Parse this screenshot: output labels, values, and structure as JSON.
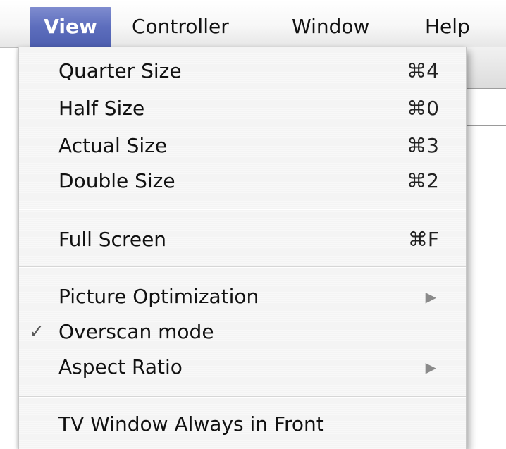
{
  "menubar": {
    "items": [
      {
        "label": "View"
      },
      {
        "label": "Controller"
      },
      {
        "label": "Window"
      },
      {
        "label": "Help"
      }
    ]
  },
  "view_menu": {
    "items": [
      {
        "label": "Quarter Size",
        "shortcut": "⌘4"
      },
      {
        "label": "Half Size",
        "shortcut": "⌘0"
      },
      {
        "label": "Actual Size",
        "shortcut": "⌘3"
      },
      {
        "label": "Double Size",
        "shortcut": "⌘2"
      },
      {
        "label": "Full Screen",
        "shortcut": "⌘F"
      },
      {
        "label": "Picture Optimization",
        "submenu_icon": "submenu-arrow-icon"
      },
      {
        "label": "Overscan mode",
        "checked": true,
        "check_mark": "✓"
      },
      {
        "label": "Aspect Ratio",
        "submenu_icon": "submenu-arrow-icon"
      },
      {
        "label": "TV Window Always in Front"
      }
    ]
  },
  "colors": {
    "active_menu": "#5d6ebd",
    "menu_background": "#f4f4f4",
    "submenu_arrow": "#8a8a8a"
  }
}
